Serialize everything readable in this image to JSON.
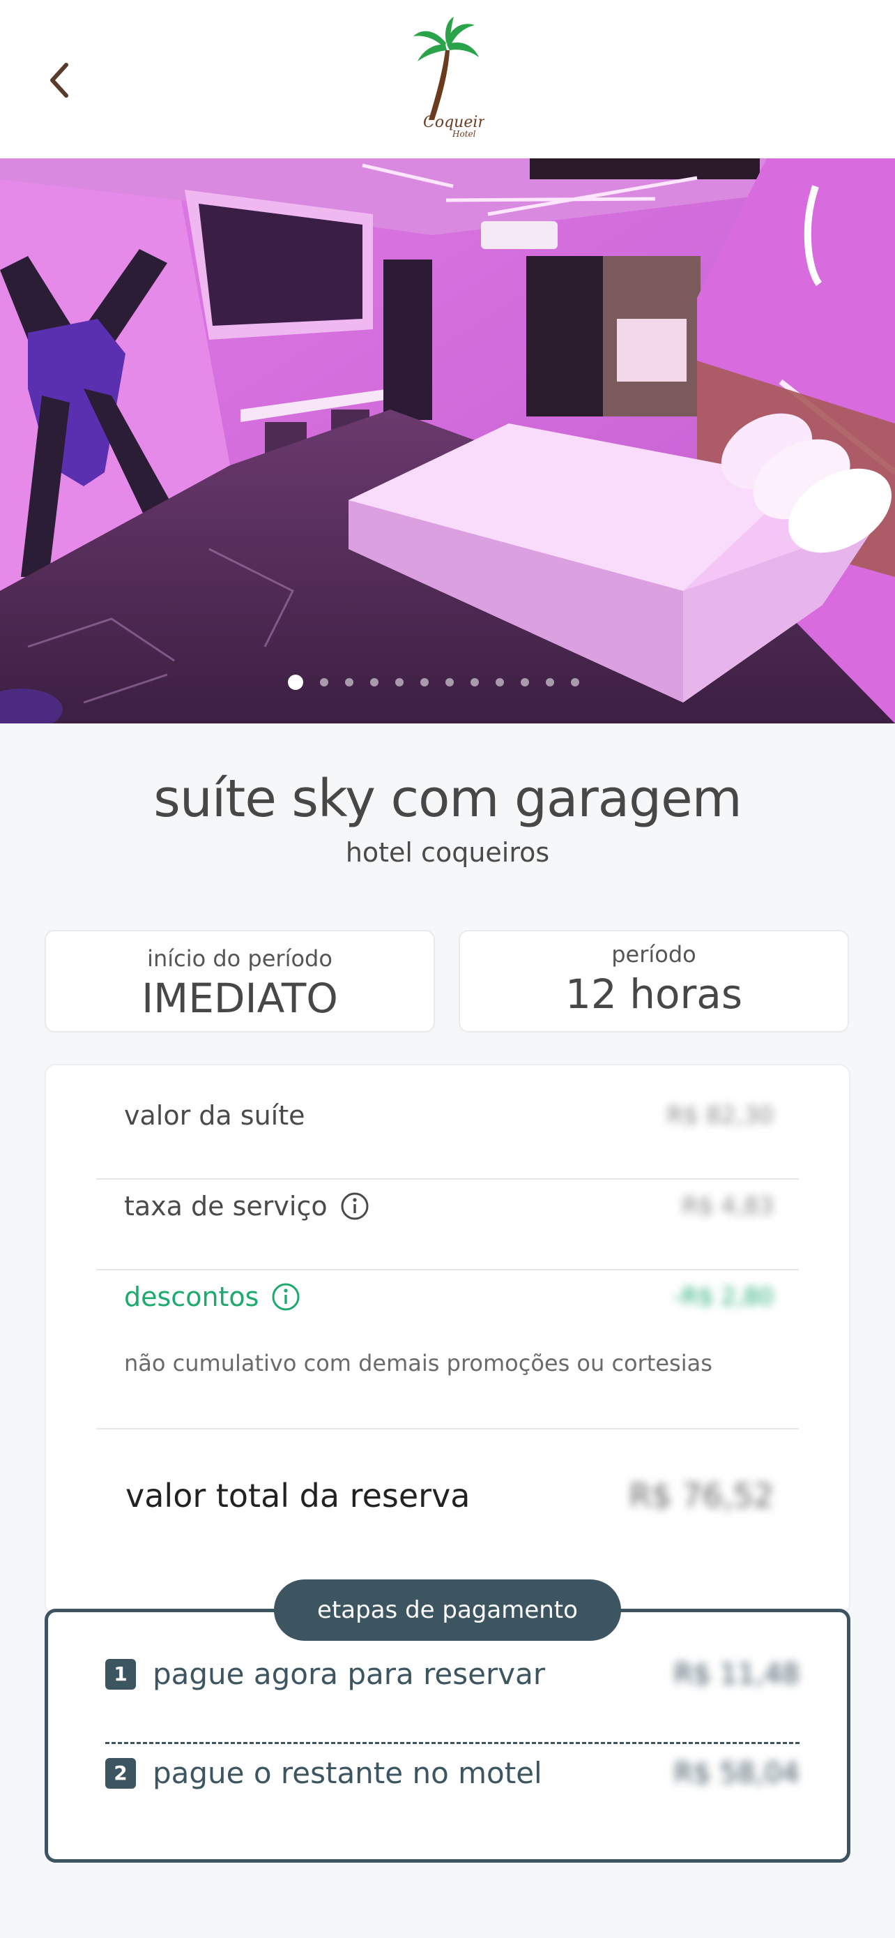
{
  "header": {
    "back_icon": "chevron-left-icon",
    "logo_text": "Coqueiros",
    "logo_sub": "Hotel"
  },
  "gallery": {
    "slide_count": 12,
    "active_index": 0
  },
  "suite": {
    "name": "suíte sky com garagem",
    "hotel": "hotel coqueiros"
  },
  "period_start": {
    "label": "início do período",
    "value": "IMEDIATO"
  },
  "period": {
    "label": "período",
    "value": "12 horas"
  },
  "pricing": {
    "suite_value_label": "valor da suíte",
    "suite_value": "R$ 82,30",
    "service_fee_label": "taxa de serviço",
    "service_fee": "R$ 4,83",
    "discounts_label": "descontos",
    "discounts": "-R$ 2,80",
    "discounts_note": "não cumulativo com demais promoções ou cortesias",
    "total_label": "valor total da reserva",
    "total": "R$ 76,52"
  },
  "payment_steps": {
    "title": "etapas de pagamento",
    "steps": [
      {
        "number": "1",
        "label": "pague agora para reservar",
        "value": "R$ 11,48"
      },
      {
        "number": "2",
        "label": "pague o restante no motel",
        "value": "R$ 58,04"
      }
    ]
  },
  "colors": {
    "accent": "#3c5561",
    "discount_green": "#1eaa6e",
    "hero_pink": "#e070e8"
  }
}
